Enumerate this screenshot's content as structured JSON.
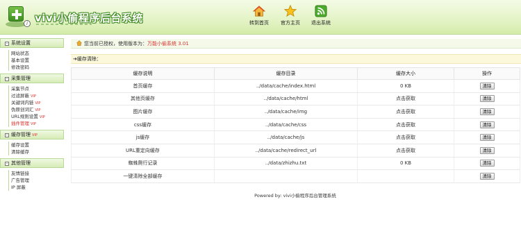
{
  "app": {
    "title": "vivi小偷程序后台系统",
    "logo_info_glyph": "i"
  },
  "topnav": [
    {
      "label": "转到首页",
      "icon": "home-icon"
    },
    {
      "label": "官方主页",
      "icon": "star-icon"
    },
    {
      "label": "退出系统",
      "icon": "rss-icon"
    }
  ],
  "sidebar": {
    "sections": [
      {
        "title": "系统设置",
        "items": [
          {
            "label": "网站状态"
          },
          {
            "label": "基本设置"
          },
          {
            "label": "修改密码"
          }
        ]
      },
      {
        "title": "采集管理",
        "items": [
          {
            "label": "采集节点"
          },
          {
            "label": "过滤屏蔽",
            "vip": "VIP"
          },
          {
            "label": "关键词内链",
            "vip": "VIP"
          },
          {
            "label": "伪原创词汇",
            "vip": "VIP"
          },
          {
            "label": "URL规则设置",
            "vip": "VIP"
          },
          {
            "label": "插件管理",
            "vip": "VIP",
            "active": true
          }
        ]
      },
      {
        "title": "缓存管理",
        "vip": "VIP",
        "items": [
          {
            "label": "缓存设置"
          },
          {
            "label": "清除缓存"
          }
        ]
      },
      {
        "title": "其他管理",
        "items": [
          {
            "label": "友情链接"
          },
          {
            "label": "广告管理"
          },
          {
            "label": "IP 屏蔽"
          }
        ]
      }
    ],
    "toggle_glyph": "–"
  },
  "breadcrumb": {
    "prefix": "您当前已授权，使用版本为：",
    "version": "万能小偷系统 3.01"
  },
  "section": {
    "title": "缓存清除："
  },
  "table": {
    "headers": [
      "缓存说明",
      "缓存目录",
      "缓存大小",
      "操作"
    ],
    "button_label": "清除",
    "rows": [
      {
        "name": "首页缓存",
        "dir": "../data/cache/index.html",
        "size": "0 KB",
        "size_red": true
      },
      {
        "name": "其他页缓存",
        "dir": "../data/cache/html",
        "size": "点击获取",
        "size_red": false
      },
      {
        "name": "图片缓存",
        "dir": "../data/cache/img",
        "size": "点击获取",
        "size_red": false
      },
      {
        "name": "css缓存",
        "dir": "../data/cache/css",
        "size": "点击获取",
        "size_red": false
      },
      {
        "name": "js缓存",
        "dir": "../data/cache/js",
        "size": "点击获取",
        "size_red": false
      },
      {
        "name": "URL重定向缓存",
        "dir": "../data/cache/redirect_url",
        "size": "点击获取",
        "size_red": false
      },
      {
        "name": "蜘蛛爬行记录",
        "dir": "../data/zhizhu.txt",
        "size": "0 KB",
        "size_red": true
      },
      {
        "name": "一键清除全部缓存",
        "dir": "",
        "size": "",
        "size_red": false
      }
    ]
  },
  "footer": {
    "text": "Powered by:  vivi小偷程序后台管理系统"
  },
  "colors": {
    "accent_green": "#3e8a1f",
    "highlight_red": "#d9302a"
  }
}
